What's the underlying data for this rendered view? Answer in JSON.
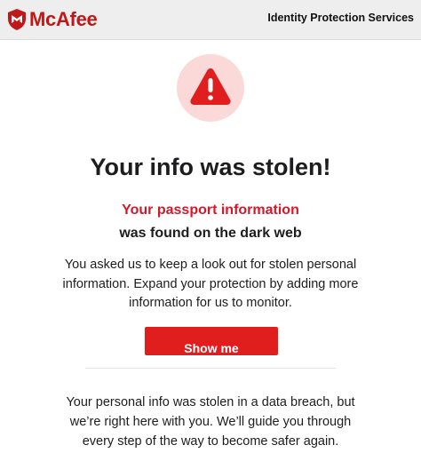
{
  "brand": {
    "name": "McAfee",
    "color": "#c01818",
    "trademark": "™"
  },
  "header": {
    "service": "Identity Protection Services"
  },
  "alert": {
    "icon": "warning-icon",
    "accent": "#d4182a"
  },
  "main": {
    "headline": "Your info was stolen!",
    "highlight": "Your passport information",
    "subline": "was found on the dark web",
    "body": "You asked us to keep a look out for stolen personal information. Expand your protection by adding more information for us to monitor.",
    "cta_label": "Show me",
    "footer_text": "Your personal info was stolen in a data breach, but we’re right here with you. We’ll guide you through every step of the way to become safer again."
  }
}
